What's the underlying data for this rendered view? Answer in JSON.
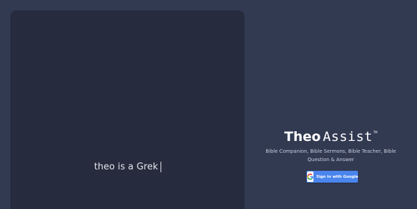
{
  "left_panel": {
    "typed_text": "theo is a Grek"
  },
  "brand": {
    "name_bold": "Theo",
    "name_light": "Assist",
    "trademark": "TM",
    "tagline": "Bible Companion, Bible Sermons, Bible Teacher, Bible Question & Answer"
  },
  "auth": {
    "google_button_label": "Sign in with Google",
    "google_icon": "google-g-icon"
  },
  "colors": {
    "background": "#323a52",
    "panel": "#262b3d",
    "google_blue": "#4a85ee"
  }
}
